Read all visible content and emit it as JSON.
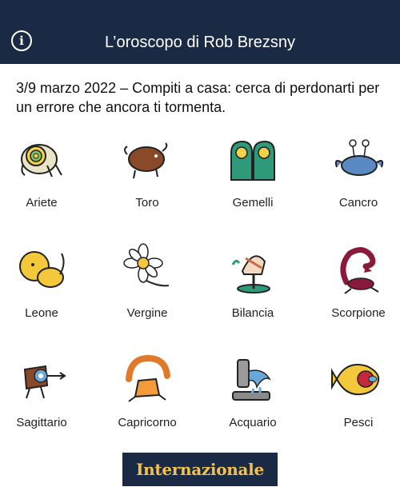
{
  "header": {
    "title": "L’oroscopo di Rob Brezsny",
    "info_icon": "info-circle-icon"
  },
  "intro": "3/9 marzo 2022 – Compiti a casa: cerca di perdonarti per un errore che ancora ti tormenta.",
  "signs": [
    {
      "label": "Ariete"
    },
    {
      "label": "Toro"
    },
    {
      "label": "Gemelli"
    },
    {
      "label": "Cancro"
    },
    {
      "label": "Leone"
    },
    {
      "label": "Vergine"
    },
    {
      "label": "Bilancia"
    },
    {
      "label": "Scorpione"
    },
    {
      "label": "Sagittario"
    },
    {
      "label": "Capricorno"
    },
    {
      "label": "Acquario"
    },
    {
      "label": "Pesci"
    }
  ],
  "footer": {
    "logo_text": "Internazionale"
  },
  "colors": {
    "header_bg": "#1a2a44",
    "logo_text": "#f2c14e"
  }
}
